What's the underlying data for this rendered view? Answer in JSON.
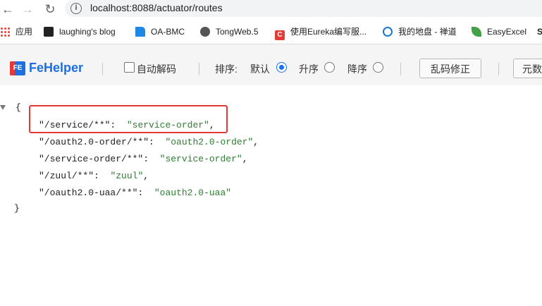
{
  "browser": {
    "url": "localhost:8088/actuator/routes",
    "bookmarks": [
      {
        "label": "应用",
        "icon": "apps-grid-icon"
      },
      {
        "label": "laughing's blog",
        "icon": "blog-icon",
        "color": "#222222"
      },
      {
        "label": "OA-BMC",
        "icon": "oa-icon",
        "color": "#1e88e5"
      },
      {
        "label": "TongWeb.5",
        "icon": "globe-icon",
        "color": "#444444"
      },
      {
        "label": "使用Eureka编写服...",
        "icon": "c-icon",
        "color": "#e53935"
      },
      {
        "label": "我的地盘 - 禅道",
        "icon": "zentao-icon",
        "color": "#1976d2"
      },
      {
        "label": "EasyExcel",
        "icon": "leaf-icon",
        "color": "#43a047"
      },
      {
        "label": "S",
        "icon": "",
        "color": ""
      }
    ]
  },
  "fehelper": {
    "title": "FeHelper",
    "logo_text": "FE",
    "auto_decode_label": "自动解码",
    "sort_label": "排序:",
    "sort_default": "默认",
    "sort_asc": "升序",
    "sort_desc": "降序",
    "fix_garbled_button": "乱码修正",
    "yuan_button": "元数"
  },
  "json": {
    "open_brace": "{",
    "close_brace": "}",
    "entries": [
      {
        "key": "\"/service/**\"",
        "value": "\"service-order\"",
        "comma": ","
      },
      {
        "key": "\"/oauth2.0-order/**\"",
        "value": "\"oauth2.0-order\"",
        "comma": ","
      },
      {
        "key": "\"/service-order/**\"",
        "value": "\"service-order\"",
        "comma": ","
      },
      {
        "key": "\"/zuul/**\"",
        "value": "\"zuul\"",
        "comma": ","
      },
      {
        "key": "\"/oauth2.0-uaa/**\"",
        "value": "\"oauth2.0-uaa\"",
        "comma": ""
      }
    ],
    "colon": ":"
  },
  "colors": {
    "highlight": "#e53935",
    "json_value": "#2e7d32",
    "brand": "#1e6fe0"
  }
}
